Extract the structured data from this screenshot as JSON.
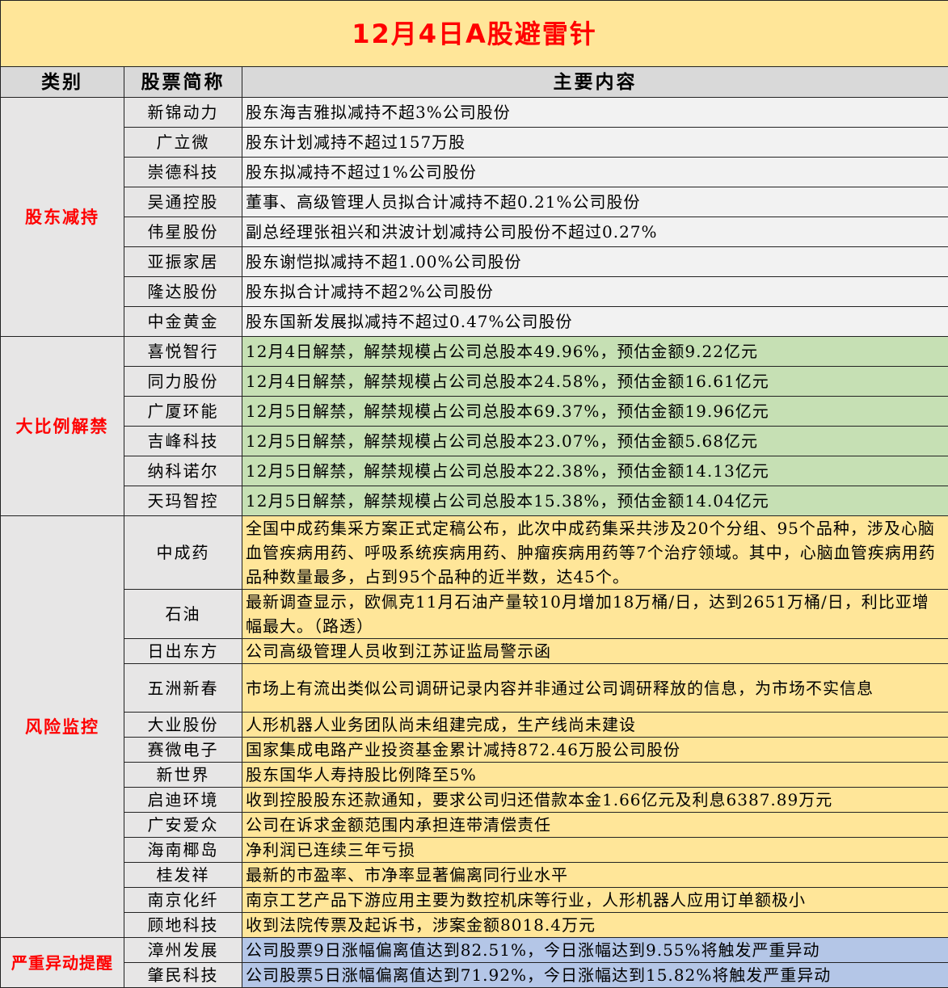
{
  "title": "12月4日A股避雷针",
  "headers": {
    "category": "类别",
    "stock": "股票简称",
    "content": "主要内容"
  },
  "colors": {
    "title_bg": "#FFE699",
    "title_text": "#FF0000",
    "header_bg": "#D9D9D9",
    "reduce_bg": "#F2F2F2",
    "unlock_bg": "#C6E0B4",
    "risk_bg": "#FFE699",
    "abnormal_bg": "#B4C6E7"
  },
  "groups": [
    {
      "category": "股东减持",
      "rows": [
        {
          "name": "新锦动力",
          "content": "股东海吉雅拟减持不超3%公司股份"
        },
        {
          "name": "广立微",
          "content": "股东计划减持不超过157万股"
        },
        {
          "name": "崇德科技",
          "content": "股东拟减持不超过1%公司股份"
        },
        {
          "name": "吴通控股",
          "content": "董事、高级管理人员拟合计减持不超0.21%公司股份"
        },
        {
          "name": "伟星股份",
          "content": "副总经理张祖兴和洪波计划减持公司股份不超过0.27%"
        },
        {
          "name": "亚振家居",
          "content": "股东谢恺拟减持不超1.00%公司股份"
        },
        {
          "name": "隆达股份",
          "content": "股东拟合计减持不超2%公司股份"
        },
        {
          "name": "中金黄金",
          "content": "股东国新发展拟减持不超过0.47%公司股份"
        }
      ]
    },
    {
      "category": "大比例解禁",
      "rows": [
        {
          "name": "喜悦智行",
          "content": "12月4日解禁，解禁规模占公司总股本49.96%，预估金额9.22亿元"
        },
        {
          "name": "同力股份",
          "content": "12月4日解禁，解禁规模占公司总股本24.58%，预估金额16.61亿元"
        },
        {
          "name": "广厦环能",
          "content": "12月5日解禁，解禁规模占公司总股本69.37%，预估金额19.96亿元"
        },
        {
          "name": "吉峰科技",
          "content": "12月5日解禁，解禁规模占公司总股本23.07%，预估金额5.68亿元"
        },
        {
          "name": "纳科诺尔",
          "content": "12月5日解禁，解禁规模占公司总股本22.38%，预估金额14.13亿元"
        },
        {
          "name": "天玛智控",
          "content": "12月5日解禁，解禁规模占公司总股本15.38%，预估金额14.04亿元"
        }
      ]
    },
    {
      "category": "风险监控",
      "rows": [
        {
          "name": "中成药",
          "content": "全国中成药集采方案正式定稿公布，此次中成药集采共涉及20个分组、95个品种，涉及心脑血管疾病用药、呼吸系统疾病用药、肿瘤疾病用药等7个治疗领域。其中，心脑血管疾病用药品种数量最多，占到95个品种的近半数，达45个。"
        },
        {
          "name": "石油",
          "content": "最新调查显示，欧佩克11月石油产量较10月增加18万桶/日，达到2651万桶/日，利比亚增幅最大。（路透）"
        },
        {
          "name": "日出东方",
          "content": "公司高级管理人员收到江苏证监局警示函"
        },
        {
          "name": "五洲新春",
          "content": "市场上有流出类似公司调研记录内容并非通过公司调研释放的信息，为市场不实信息"
        },
        {
          "name": "大业股份",
          "content": "人形机器人业务团队尚未组建完成，生产线尚未建设"
        },
        {
          "name": "赛微电子",
          "content": "国家集成电路产业投资基金累计减持872.46万股公司股份"
        },
        {
          "name": "新世界",
          "content": "股东国华人寿持股比例降至5%"
        },
        {
          "name": "启迪环境",
          "content": "收到控股股东还款通知，要求公司归还借款本金1.66亿元及利息6387.89万元"
        },
        {
          "name": "广安爱众",
          "content": "公司在诉求金额范围内承担连带清偿责任"
        },
        {
          "name": "海南椰岛",
          "content": "净利润已连续三年亏损"
        },
        {
          "name": "桂发祥",
          "content": "最新的市盈率、市净率显著偏离同行业水平"
        },
        {
          "name": "南京化纤",
          "content": "南京工艺产品下游应用主要为数控机床等行业，人形机器人应用订单额极小"
        },
        {
          "name": "顾地科技",
          "content": "收到法院传票及起诉书，涉案金额8018.4万元"
        }
      ]
    },
    {
      "category": "严重异动提醒",
      "rows": [
        {
          "name": "漳州发展",
          "content": "公司股票9日涨幅偏离值达到82.51%，今日涨幅达到9.55%将触发严重异动"
        },
        {
          "name": "肇民科技",
          "content": "公司股票5日涨幅偏离值达到71.92%，今日涨幅达到15.82%将触发严重异动"
        }
      ]
    }
  ]
}
